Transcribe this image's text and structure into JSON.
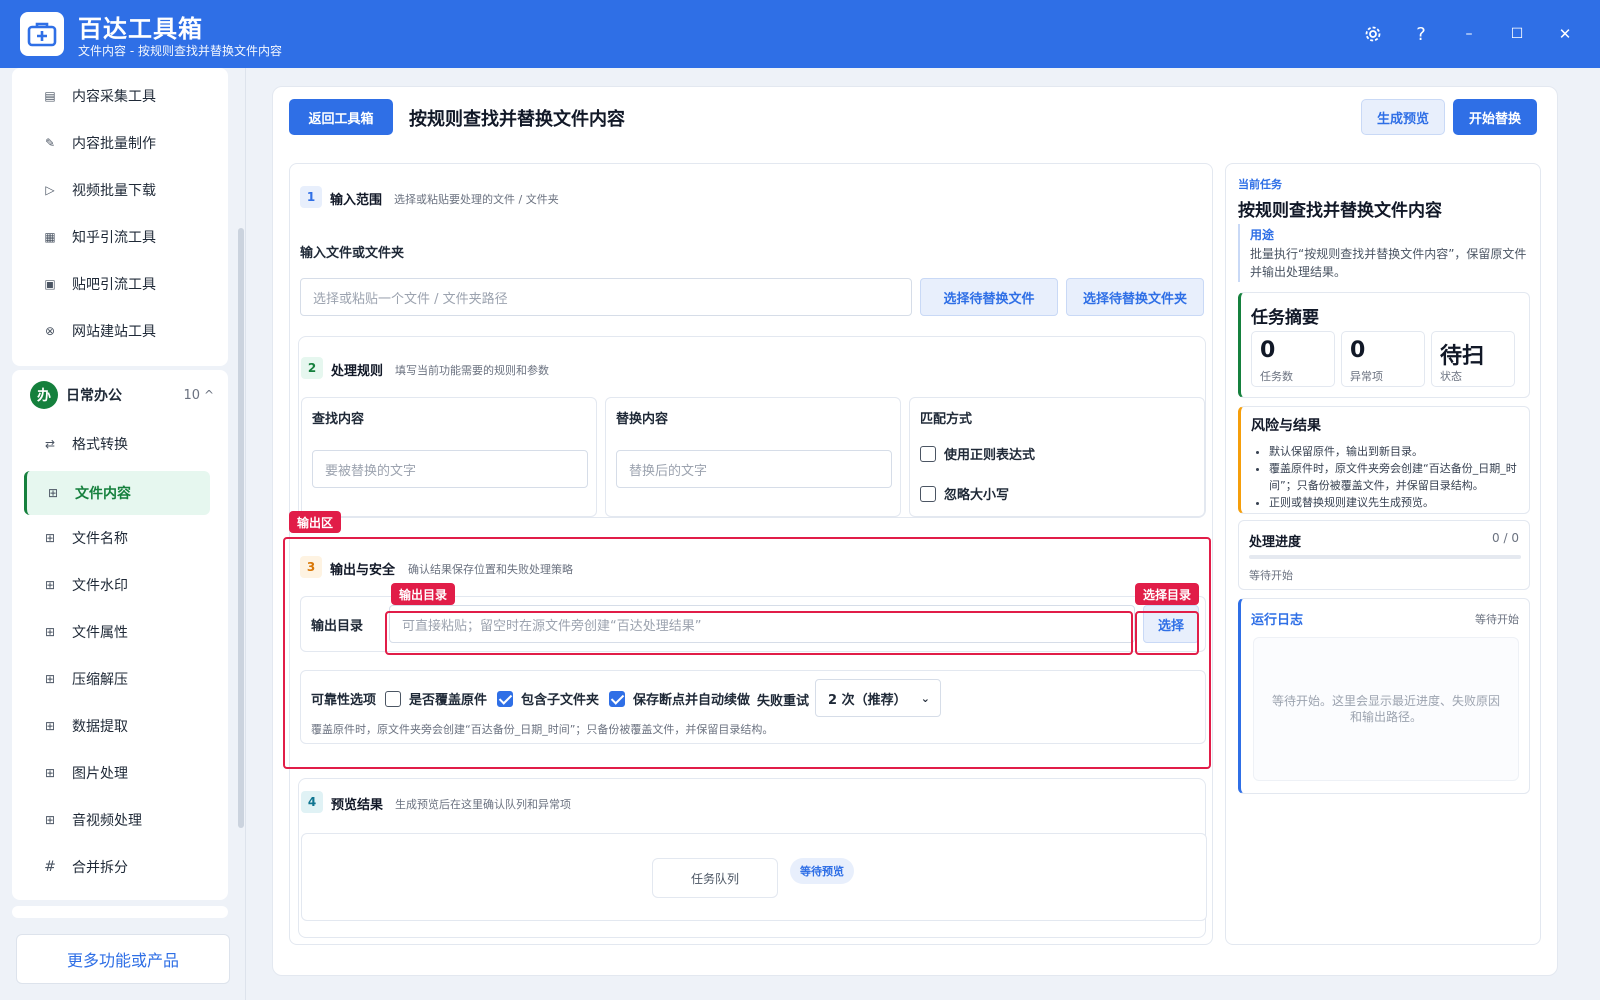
{
  "app": {
    "title": "百达工具箱",
    "subtitle": "文件内容 - 按规则查找并替换文件内容"
  },
  "window_controls": {
    "settings_icon": "gear-icon",
    "help": "?",
    "minimize": "–",
    "maximize": "☐",
    "close": "✕"
  },
  "sidebar": {
    "top_items": [
      {
        "label": "内容采集工具",
        "icon": "book-icon"
      },
      {
        "label": "内容批量制作",
        "icon": "pen-icon"
      },
      {
        "label": "视频批量下载",
        "icon": "video-icon"
      },
      {
        "label": "知乎引流工具",
        "icon": "zhihu-icon"
      },
      {
        "label": "贴吧引流工具",
        "icon": "forum-icon"
      },
      {
        "label": "网站建站工具",
        "icon": "globe-icon"
      }
    ],
    "group": {
      "badge": "办",
      "title": "日常办公",
      "count": "10",
      "caret": "^"
    },
    "group_items": [
      {
        "label": "格式转换",
        "icon": "swap-icon"
      },
      {
        "label": "文件内容",
        "icon": "grid-icon",
        "active": true
      },
      {
        "label": "文件名称",
        "icon": "grid-icon"
      },
      {
        "label": "文件水印",
        "icon": "grid-icon"
      },
      {
        "label": "文件属性",
        "icon": "grid-icon"
      },
      {
        "label": "压缩解压",
        "icon": "grid-icon"
      },
      {
        "label": "数据提取",
        "icon": "grid-icon"
      },
      {
        "label": "图片处理",
        "icon": "grid-icon"
      },
      {
        "label": "音视频处理",
        "icon": "grid-icon"
      },
      {
        "label": "合并拆分",
        "icon": "hash-icon"
      }
    ],
    "more_button": "更多功能或产品"
  },
  "toolbar": {
    "back": "返回工具箱",
    "title": "按规则查找并替换文件内容",
    "preview": "生成预览",
    "start": "开始替换"
  },
  "sections": {
    "s1": {
      "num": "1",
      "title": "输入范围",
      "desc": "选择或粘贴要处理的文件 / 文件夹",
      "field_label": "输入文件或文件夹",
      "placeholder": "选择或粘贴一个文件 / 文件夹路径",
      "btn_file": "选择待替换文件",
      "btn_folder": "选择待替换文件夹"
    },
    "s2": {
      "num": "2",
      "title": "处理规则",
      "desc": "填写当前功能需要的规则和参数",
      "find_label": "查找内容",
      "find_placeholder": "要被替换的文字",
      "replace_label": "替换内容",
      "replace_placeholder": "替换后的文字",
      "match_label": "匹配方式",
      "regex": "使用正则表达式",
      "ignore_case": "忽略大小写"
    },
    "s3": {
      "num": "3",
      "title": "输出与安全",
      "desc": "确认结果保存位置和失败处理策略",
      "out_label": "输出目录",
      "out_placeholder": "可直接粘贴；留空时在源文件旁创建“百达处理结果”",
      "choose": "选择",
      "reliability_label": "可靠性选项",
      "overwrite": "是否覆盖原件",
      "include_sub": "包含子文件夹",
      "resume": "保存断点并自动续做",
      "retry_label": "失败重试",
      "retry_value": "2 次（推荐）",
      "note": "覆盖原件时，原文件夹旁会创建“百达备份_日期_时间”；只备份被覆盖文件，并保留目录结构。"
    },
    "s4": {
      "num": "4",
      "title": "预览结果",
      "desc": "生成预览后在这里确认队列和异常项",
      "queue": "任务队列",
      "status": "等待预览"
    }
  },
  "callouts": {
    "output_area": "输出区",
    "output_dir": "输出目录",
    "select_dir": "选择目录"
  },
  "right": {
    "label": "当前任务",
    "title": "按规则查找并替换文件内容",
    "purpose_label": "用途",
    "purpose_text": "批量执行“按规则查找并替换文件内容”，保留原文件并输出处理结果。",
    "summary_title": "任务摘要",
    "stats": [
      {
        "value": "0",
        "label": "任务数"
      },
      {
        "value": "0",
        "label": "异常项"
      },
      {
        "value": "待扫",
        "label": "状态"
      }
    ],
    "risk_title": "风险与结果",
    "risks": [
      "默认保留原件，输出到新目录。",
      "覆盖原件时，原文件夹旁会创建“百达备份_日期_时间”；只备份被覆盖文件，并保留目录结构。",
      "正则或替换规则建议先生成预览。"
    ],
    "progress_title": "处理进度",
    "progress_count": "0 / 0",
    "progress_value": 0,
    "progress_status": "等待开始",
    "log_title": "运行日志",
    "log_status": "等待开始",
    "log_placeholder": "等待开始。这里会显示最近进度、失败原因和输出路径。"
  },
  "colors": {
    "brand": "#2f6fe6",
    "active_green": "#15803d",
    "callout_red": "#e11d48",
    "warning_orange": "#f59e0b"
  }
}
